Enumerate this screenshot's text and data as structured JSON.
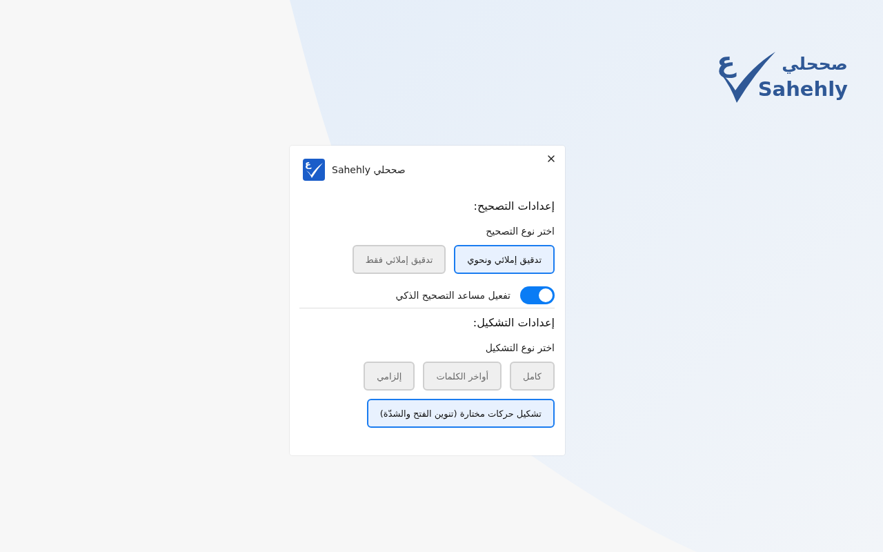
{
  "logo": {
    "letter": "ع",
    "arabic": "صححلي",
    "latin": "Sahehly"
  },
  "dialog": {
    "app_letter": "ع",
    "title": "صححلي Sahehly",
    "correction": {
      "heading": "إعدادات التصحيح:",
      "label": "اختر نوع التصحيح",
      "options": [
        {
          "label": "تدقيق إملائي ونحوي",
          "selected": true
        },
        {
          "label": "تدقيق إملائي فقط",
          "selected": false
        }
      ],
      "assistant": {
        "label": "تفعيل مساعد التصحيح الذكي",
        "on": true
      }
    },
    "diacritics": {
      "heading": "إعدادات التشكيل:",
      "label": "اختر نوع التشكيل",
      "options": [
        {
          "label": "كامل",
          "selected": false
        },
        {
          "label": "أواخر الكلمات",
          "selected": false
        },
        {
          "label": "إلزامي",
          "selected": false
        },
        {
          "label": "تشكيل حركات مختارة (تنوين الفتح والشدّة)",
          "selected": true
        }
      ]
    }
  }
}
